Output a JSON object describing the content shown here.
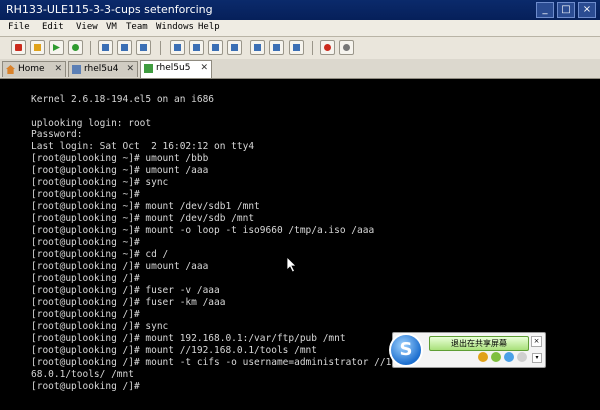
{
  "window": {
    "title": "RH133-ULE115-3-3-cups setenforcing",
    "controls": [
      "_",
      "□",
      "×"
    ]
  },
  "menubar": {
    "items": [
      "File",
      "Edit",
      "View",
      "VM",
      "Team",
      "Windows",
      "Help"
    ]
  },
  "toolbar": {
    "buttons": [
      {
        "name": "power-off-icon",
        "color": "#cc2b1d"
      },
      {
        "name": "pause-icon",
        "color": "#e0a21a"
      },
      {
        "name": "play-icon",
        "color": "#2f9b2f"
      },
      {
        "name": "reset-icon",
        "color": "#2f9b2f"
      },
      {
        "name": "snapshot-icon",
        "color": "#3b6fb5"
      },
      {
        "name": "revert-snapshot-icon",
        "color": "#3b6fb5"
      },
      {
        "name": "snapshot-manager-icon",
        "color": "#3b6fb5"
      },
      {
        "name": "sidebar-icon",
        "color": "#3b6fb5"
      },
      {
        "name": "quick-switch-icon",
        "color": "#3b6fb5"
      },
      {
        "name": "console-view-icon",
        "color": "#3b6fb5"
      },
      {
        "name": "summary-view-icon",
        "color": "#3b6fb5"
      },
      {
        "name": "appliance-view-icon",
        "color": "#3b6fb5"
      },
      {
        "name": "full-screen-icon",
        "color": "#3b6fb5"
      },
      {
        "name": "record-icon",
        "color": "#cc2b1d"
      },
      {
        "name": "settings-icon",
        "color": "#777777"
      }
    ]
  },
  "tabs": [
    {
      "label": "Home",
      "active": false
    },
    {
      "label": "rhel5u4",
      "active": false
    },
    {
      "label": "rhel5u5",
      "active": true
    }
  ],
  "terminal": {
    "lines": [
      "Kernel 2.6.18-194.el5 on an i686",
      "",
      "uplooking login: root",
      "Password:",
      "Last login: Sat Oct  2 16:02:12 on tty4",
      "[root@uplooking ~]# umount /bbb",
      "[root@uplooking ~]# umount /aaa",
      "[root@uplooking ~]# sync",
      "[root@uplooking ~]#",
      "[root@uplooking ~]# mount /dev/sdb1 /mnt",
      "[root@uplooking ~]# mount /dev/sdb /mnt",
      "[root@uplooking ~]# mount -o loop -t iso9660 /tmp/a.iso /aaa",
      "[root@uplooking ~]#",
      "[root@uplooking ~]# cd /",
      "[root@uplooking /]# umount /aaa",
      "[root@uplooking /]#",
      "[root@uplooking /]# fuser -v /aaa",
      "[root@uplooking /]# fuser -km /aaa",
      "[root@uplooking /]#",
      "[root@uplooking /]# sync",
      "[root@uplooking /]# mount 192.168.0.1:/var/ftp/pub /mnt",
      "[root@uplooking /]# mount //192.168.0.1/tools /mnt",
      "[root@uplooking /]# mount -t cifs -o username=administrator //192.1",
      "68.0.1/tools/ /mnt",
      "[root@uplooking /]#"
    ]
  },
  "share_popup": {
    "button_label": "退出在共享屏幕",
    "logo_glyph": "S",
    "close_glyph": "×",
    "expand_glyph": "▾",
    "icon_colors": [
      "#e0a21a",
      "#7fbf3f",
      "#4aa0e6",
      "#cfcfcf"
    ]
  }
}
